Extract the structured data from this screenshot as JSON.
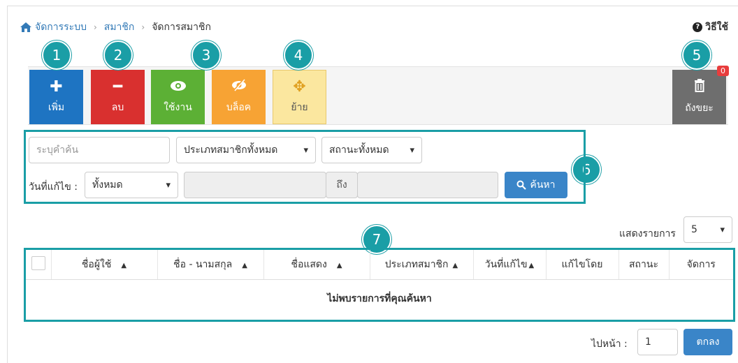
{
  "breadcrumb": {
    "home": "จัดการระบบ",
    "section": "สมาชิก",
    "current": "จัดการสมาชิก",
    "separator": "›"
  },
  "help": {
    "label": "วิธีใช้",
    "icon": "question-circle-icon"
  },
  "toolbar": {
    "add": {
      "label": "เพิ่ม",
      "icon": "plus-icon",
      "color": "#1e74c2"
    },
    "delete": {
      "label": "ลบ",
      "icon": "minus-icon",
      "color": "#d9302f"
    },
    "activate": {
      "label": "ใช้งาน",
      "icon": "eye-icon",
      "color": "#5cb035"
    },
    "block": {
      "label": "บล็อค",
      "icon": "eye-slash-icon",
      "color": "#f7a334"
    },
    "move": {
      "label": "ย้าย",
      "icon": "arrows-move-icon",
      "color": "#fbe79f"
    },
    "trash": {
      "label": "ถังขยะ",
      "icon": "trash-icon",
      "count": "0",
      "color": "#6e6e6e"
    }
  },
  "callouts": [
    "1",
    "2",
    "3",
    "4",
    "5",
    "6",
    "7"
  ],
  "search": {
    "keyword_placeholder": "ระบุคำค้น",
    "member_type": "ประเภทสมาชิกทั้งหมด",
    "status": "สถานะทั้งหมด",
    "date_label": "วันที่แก้ไข :",
    "date_range": "ทั้งหมด",
    "to_label": "ถึง",
    "button": "ค้นหา"
  },
  "page_size": {
    "label": "แสดงรายการ",
    "value": "5"
  },
  "table": {
    "columns": [
      "ชื่อผู้ใช้",
      "ชื่อ - นามสกุล",
      "ชื่อแสดง",
      "ประเภทสมาชิก",
      "วันที่แก้ไข",
      "แก้ไขโดย",
      "สถานะ",
      "จัดการ"
    ],
    "sort_arrow": "▲",
    "empty_message": "ไม่พบรายการที่คุณค้นหา"
  },
  "pager": {
    "label": "ไปหน้า :",
    "value": "1",
    "button": "ตกลง"
  },
  "accent_color": "#1a9ea6"
}
